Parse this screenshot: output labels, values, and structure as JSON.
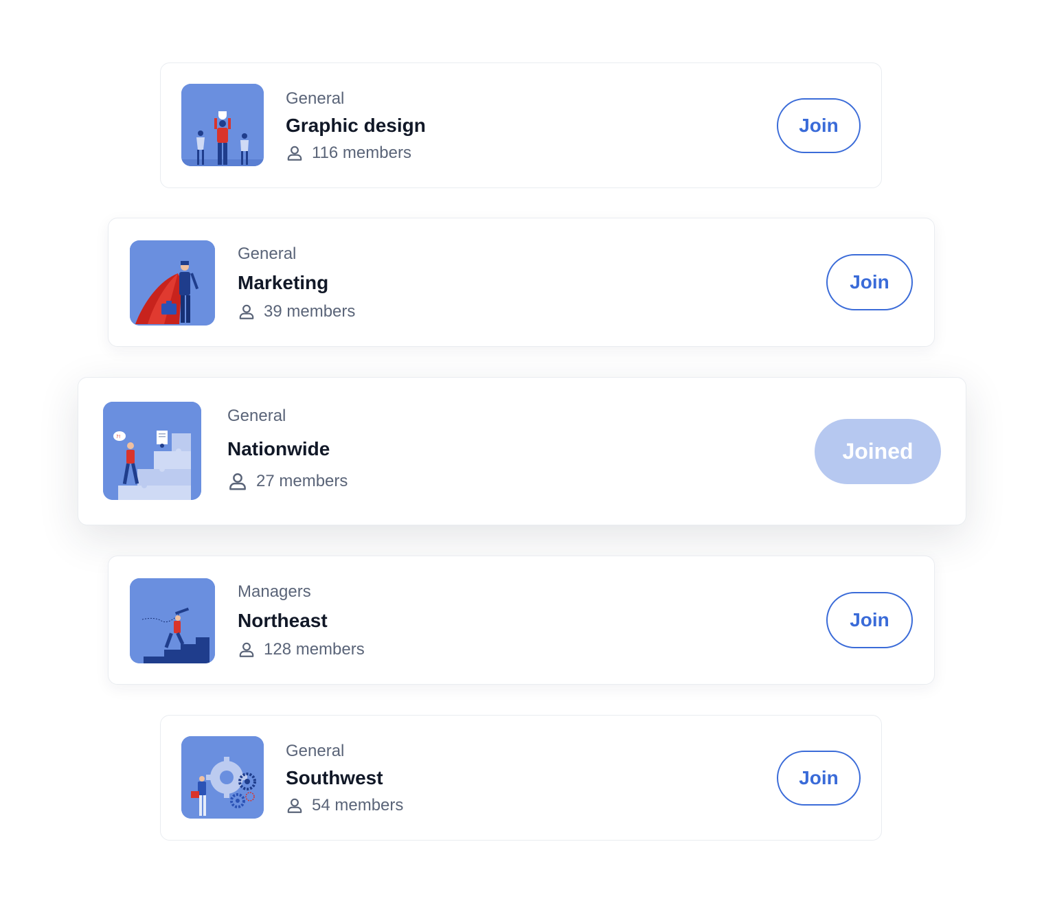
{
  "groups": [
    {
      "category": "General",
      "name": "Graphic design",
      "members": "116 members",
      "button": "Join",
      "illustration": "team-trophy-illustration",
      "joined": false
    },
    {
      "category": "General",
      "name": "Marketing",
      "members": "39 members",
      "button": "Join",
      "illustration": "superhero-businessman-illustration",
      "joined": false
    },
    {
      "category": "General",
      "name": "Nationwide",
      "members": "27 members",
      "button": "Joined",
      "illustration": "puzzle-stairs-illustration",
      "joined": true
    },
    {
      "category": "Managers",
      "name": "Northeast",
      "members": "128 members",
      "button": "Join",
      "illustration": "telescope-stairs-illustration",
      "joined": false
    },
    {
      "category": "General",
      "name": "Southwest",
      "members": "54 members",
      "button": "Join",
      "illustration": "gears-illustration",
      "joined": false
    }
  ],
  "colors": {
    "accent": "#3a6bd8",
    "thumb_bg": "#6a8fdf",
    "joined_bg": "#b6c8f0",
    "red": "#d9342b",
    "navy": "#1f3d8c"
  }
}
